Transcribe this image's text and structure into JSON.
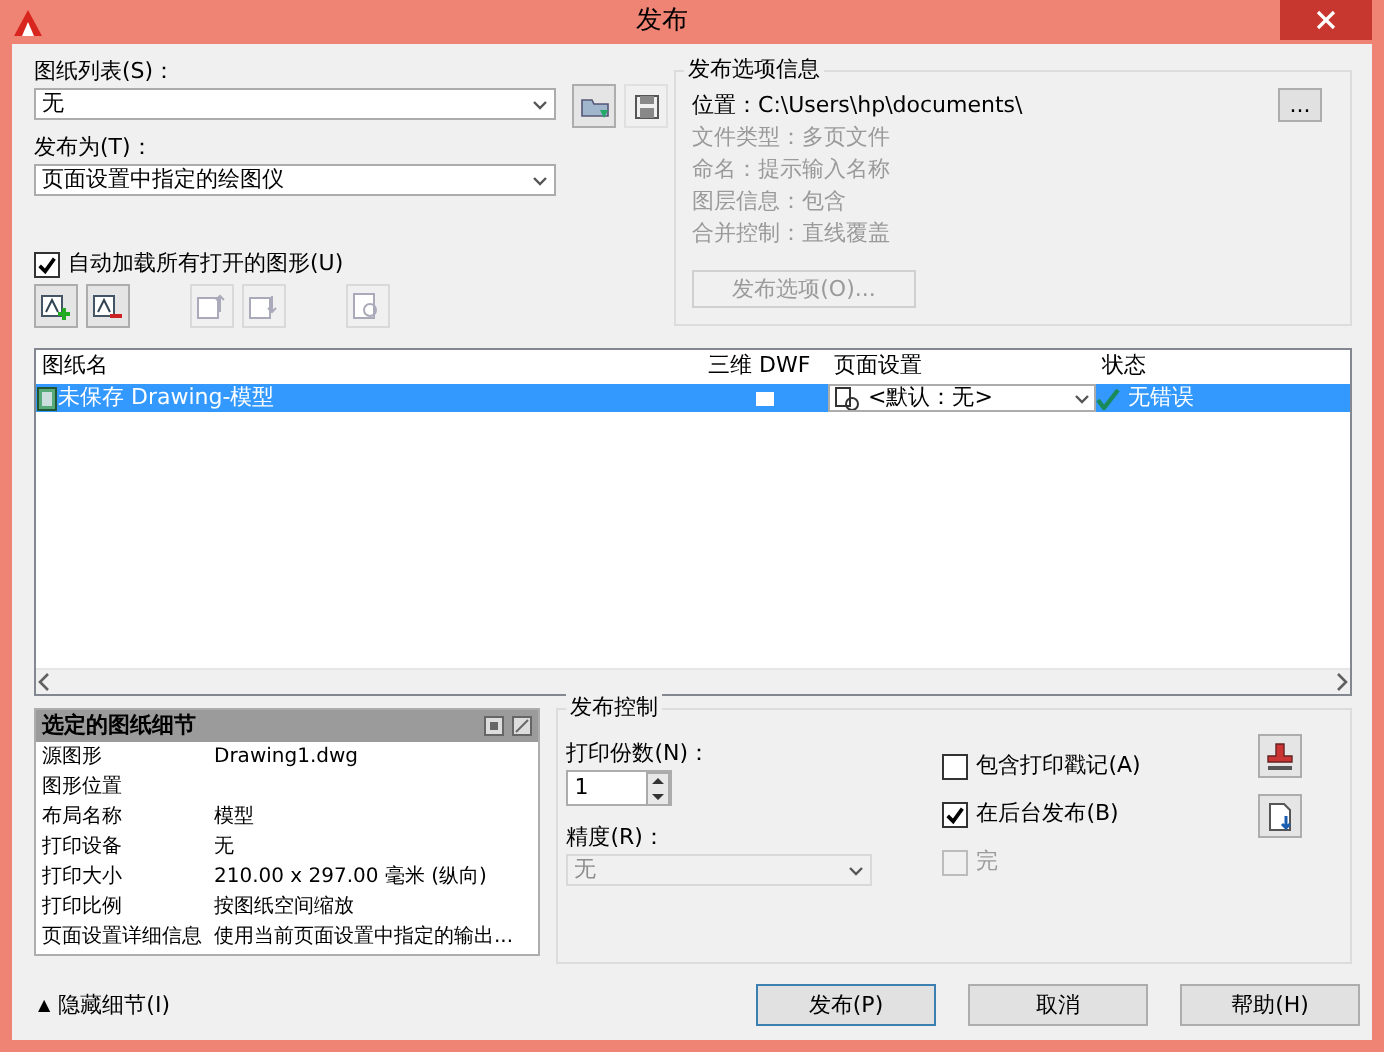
{
  "window": {
    "title": "发布"
  },
  "sheet_list": {
    "label": "图纸列表(S)：",
    "value": "无"
  },
  "publish_to": {
    "label": "发布为(T)：",
    "value": "页面设置中指定的绘图仪"
  },
  "auto_load": {
    "label": "自动加载所有打开的图形(U)",
    "checked": true
  },
  "sheet_tools": [
    {
      "kind": "add",
      "disabled": false
    },
    {
      "kind": "remove",
      "disabled": false
    },
    {
      "kind": "up",
      "disabled": true
    },
    {
      "kind": "down",
      "disabled": true
    },
    {
      "kind": "preview",
      "disabled": true
    }
  ],
  "publish_options": {
    "title": "发布选项信息",
    "location": "位置：C:\\Users\\hp\\documents\\",
    "browse_button": "...",
    "details": [
      {
        "text": "文件类型：多页文件",
        "disabled": true
      },
      {
        "text": "命名：提示输入名称",
        "disabled": true
      },
      {
        "text": "图层信息：包含",
        "disabled": true
      },
      {
        "text": "合并控制：直线覆盖",
        "disabled": true
      }
    ],
    "button": {
      "label": "发布选项(O)...",
      "disabled": true
    }
  },
  "sheets": {
    "columns": [
      "图纸名",
      "三维 DWF",
      "页面设置",
      "状态"
    ],
    "rows": [
      {
        "name": "未保存 Drawing-模型",
        "dwf_3d": false,
        "page_setup": "<默认：无>",
        "status": "无错误",
        "selected": true
      }
    ]
  },
  "sheet_details": {
    "title": "选定的图纸细节",
    "rows": [
      {
        "label": "源图形",
        "value": "Drawing1.dwg"
      },
      {
        "label": "图形位置"
      },
      {
        "label": "布局名称",
        "value": "模型"
      },
      {
        "label": "打印设备",
        "value": "无"
      },
      {
        "label": "打印大小",
        "value": "210.00 x 297.00 毫米 (纵向)"
      },
      {
        "label": "打印比例",
        "value": "按图纸空间缩放"
      },
      {
        "label": "页面设置详细信息",
        "value": "使用当前页面设置中指定的输出..."
      }
    ]
  },
  "publish_control": {
    "title": "发布控制",
    "copies": {
      "label": "打印份数(N)：",
      "value": "1"
    },
    "precision": {
      "label": "精度(R)：",
      "value": "无",
      "disabled": true
    },
    "options": [
      {
        "label": "包含打印戳记(A)",
        "checked": false,
        "disabled": false
      },
      {
        "label": "在后台发布(B)",
        "checked": true,
        "disabled": false
      },
      {
        "label": "完",
        "checked": false,
        "disabled": true
      }
    ]
  },
  "toggle": {
    "arrow": "▲",
    "label": "隐藏细节(I)"
  },
  "buttons": [
    {
      "label": "发布(P)",
      "default": true
    },
    {
      "label": "取消",
      "default": false
    },
    {
      "label": "帮助(H)",
      "default": false
    }
  ]
}
